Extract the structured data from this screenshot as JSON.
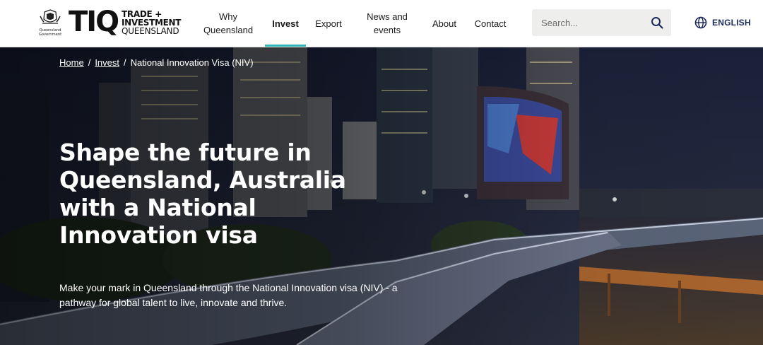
{
  "brand": {
    "crest_line1": "Queensland",
    "crest_line2": "Government",
    "logo_letters": "TIQ",
    "line1": "TRADE +",
    "line2": "INVESTMENT",
    "line3": "QUEENSLAND"
  },
  "nav": {
    "items": [
      {
        "label": "Why Queensland"
      },
      {
        "label": "Invest",
        "active": true
      },
      {
        "label": "Export"
      },
      {
        "label": "News and events"
      },
      {
        "label": "About"
      },
      {
        "label": "Contact"
      }
    ]
  },
  "search": {
    "placeholder": "Search...",
    "icon": "search-icon"
  },
  "language": {
    "label": "ENGLISH",
    "icon": "globe-icon"
  },
  "colors": {
    "accent": "#2fb5b8",
    "language_text": "#1a2a5a"
  },
  "breadcrumb": {
    "items": [
      {
        "label": "Home",
        "link": true
      },
      {
        "label": "Invest",
        "link": true
      },
      {
        "label": "National Innovation Visa (NIV)",
        "link": false
      }
    ],
    "separator": "/"
  },
  "hero": {
    "title": "Shape the future in Queensland, Australia with a National Innovation visa",
    "description": "Make your mark in Queensland through the National Innovation visa (NIV) - a pathway for global talent to live, innovate and thrive."
  }
}
